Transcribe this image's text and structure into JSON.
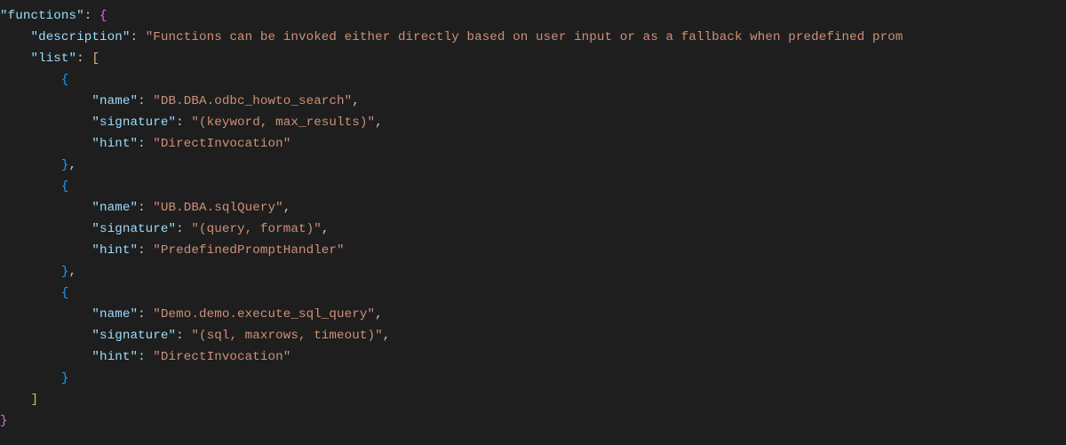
{
  "code": {
    "root_key": "\"functions\"",
    "description_key": "\"description\"",
    "description_val": "\"Functions can be invoked either directly based on user input or as a fallback when predefined prom",
    "list_key": "\"list\"",
    "name_key": "\"name\"",
    "signature_key": "\"signature\"",
    "hint_key": "\"hint\"",
    "items": [
      {
        "name": "\"DB.DBA.odbc_howto_search\"",
        "signature": "\"(keyword, max_results)\"",
        "hint": "\"DirectInvocation\""
      },
      {
        "name": "\"UB.DBA.sqlQuery\"",
        "signature": "\"(query, format)\"",
        "hint": "\"PredefinedPromptHandler\""
      },
      {
        "name": "\"Demo.demo.execute_sql_query\"",
        "signature": "\"(sql, maxrows, timeout)\"",
        "hint": "\"DirectInvocation\""
      }
    ]
  }
}
